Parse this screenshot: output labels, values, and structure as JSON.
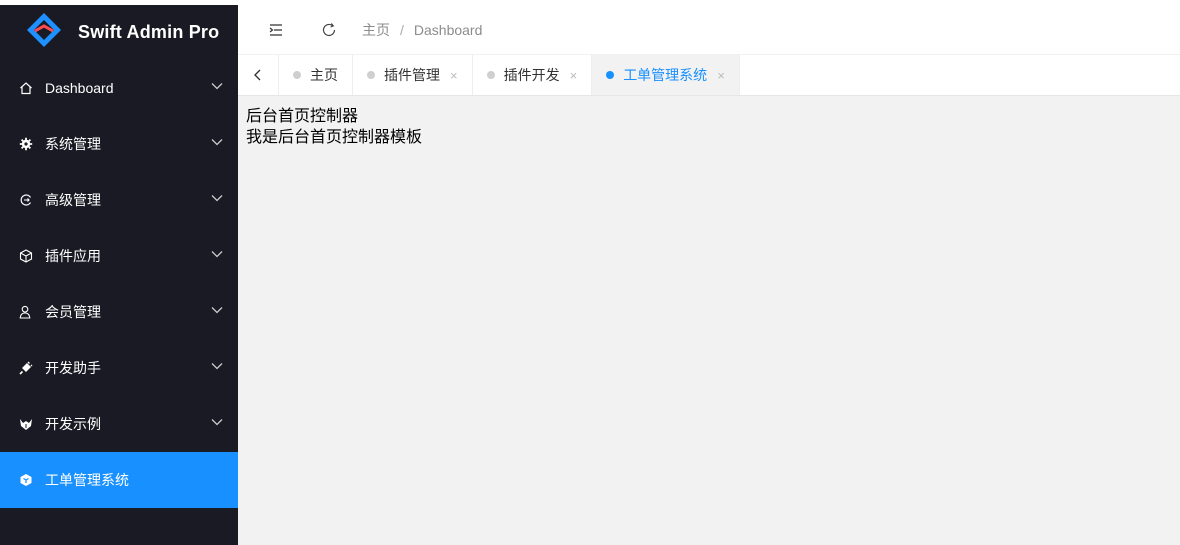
{
  "app": {
    "title": "Swift Admin Pro"
  },
  "sidebar": {
    "items": [
      {
        "label": "Dashboard",
        "icon": "home-icon",
        "has_arrow": true
      },
      {
        "label": "系统管理",
        "icon": "gear-icon",
        "has_arrow": true
      },
      {
        "label": "高级管理",
        "icon": "refresh-icon",
        "has_arrow": true
      },
      {
        "label": "插件应用",
        "icon": "cube-icon",
        "has_arrow": true
      },
      {
        "label": "会员管理",
        "icon": "user-icon",
        "has_arrow": true
      },
      {
        "label": "开发助手",
        "icon": "plug-icon",
        "has_arrow": true
      },
      {
        "label": "开发示例",
        "icon": "fox-icon",
        "has_arrow": true
      },
      {
        "label": "工单管理系统",
        "icon": "box-icon",
        "has_arrow": false,
        "active": true
      }
    ]
  },
  "header": {
    "breadcrumb": [
      "主页",
      "Dashboard"
    ],
    "breadcrumb_separator": "/"
  },
  "tabs": [
    {
      "label": "主页",
      "closable": false,
      "active": false
    },
    {
      "label": "插件管理",
      "closable": true,
      "active": false
    },
    {
      "label": "插件开发",
      "closable": true,
      "active": false
    },
    {
      "label": "工单管理系统",
      "closable": true,
      "active": true
    }
  ],
  "tab_close_glyph": "×",
  "content": {
    "line1": "后台首页控制器",
    "line2": "我是后台首页控制器模板"
  },
  "colors": {
    "sidebar_bg": "#191a23",
    "accent": "#1890ff",
    "content_bg": "#f2f2f2"
  }
}
